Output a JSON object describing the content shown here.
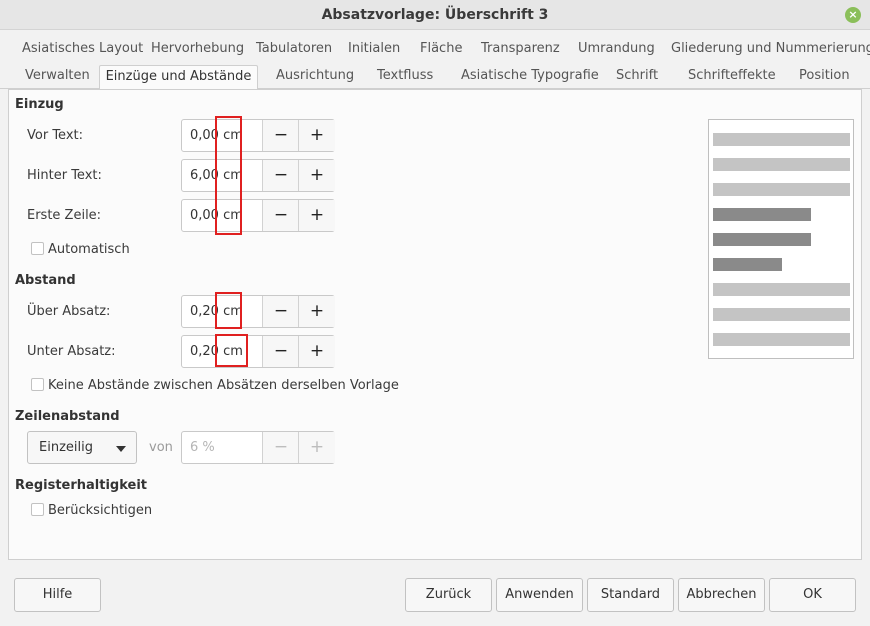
{
  "window": {
    "title": "Absatzvorlage: Überschrift 3",
    "close_glyph": "×"
  },
  "tabs": {
    "row1": [
      "Asiatisches Layout",
      "Hervorhebung",
      "Tabulatoren",
      "Initialen",
      "Fläche",
      "Transparenz",
      "Umrandung",
      "Gliederung und Nummerierung"
    ],
    "row2": [
      "Verwalten",
      "Einzüge und Abstände",
      "Ausrichtung",
      "Textfluss",
      "Asiatische Typografie",
      "Schrift",
      "Schrifteffekte",
      "Position"
    ],
    "active": "Einzüge und Abstände"
  },
  "einzug": {
    "heading": "Einzug",
    "vor_text": {
      "label": "Vor Text:",
      "value": "0,00 cm"
    },
    "hinter_text": {
      "label": "Hinter Text:",
      "value": "6,00 cm"
    },
    "erste_zeile": {
      "label": "Erste Zeile:",
      "value": "0,00 cm"
    },
    "automatisch": {
      "label": "Automatisch",
      "checked": false
    }
  },
  "abstand": {
    "heading": "Abstand",
    "ueber_absatz": {
      "label": "Über Absatz:",
      "value": "0,20 cm"
    },
    "unter_absatz": {
      "label": "Unter Absatz:",
      "value": "0,20 cm"
    },
    "keine_abstaende": {
      "label": "Keine Abstände zwischen Absätzen derselben Vorlage",
      "checked": false
    }
  },
  "zeilenabstand": {
    "heading": "Zeilenabstand",
    "mode": "Einzeilig",
    "von_label": "von",
    "value": "6 %"
  },
  "registerhaltigkeit": {
    "heading": "Registerhaltigkeit",
    "beruecksichtigen": {
      "label": "Berücksichtigen",
      "checked": false
    }
  },
  "spin_glyphs": {
    "minus": "−",
    "plus": "+"
  },
  "buttons": {
    "hilfe": "Hilfe",
    "zurueck": "Zurück",
    "anwenden": "Anwenden",
    "standard": "Standard",
    "abbrechen": "Abbrechen",
    "ok": "OK"
  },
  "colors": {
    "annotation_red": "#e02020",
    "close_green": "#8bbf5a"
  }
}
